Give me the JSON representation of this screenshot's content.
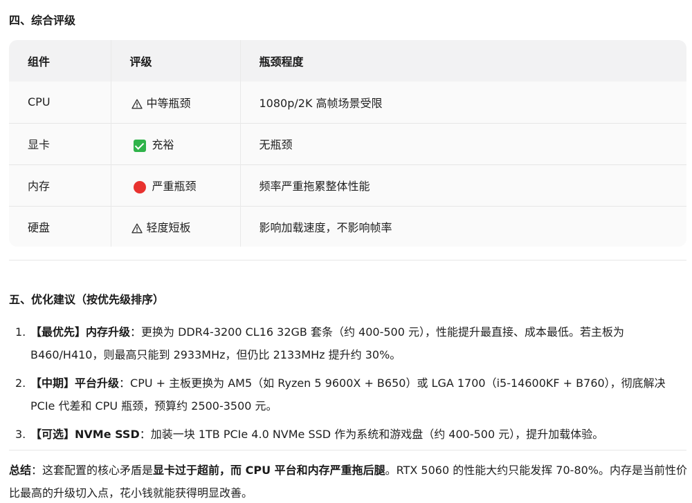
{
  "section4": {
    "title": "四、综合评级",
    "table": {
      "headers": [
        "组件",
        "评级",
        "瓶颈程度"
      ],
      "rows": [
        {
          "component": "CPU",
          "rating_icon": "warning-icon",
          "rating": "中等瓶颈",
          "impact": "1080p/2K 高帧场景受限"
        },
        {
          "component": "显卡",
          "rating_icon": "green-check-icon",
          "rating": "充裕",
          "impact": "无瓶颈"
        },
        {
          "component": "内存",
          "rating_icon": "red-circle-icon",
          "rating": "严重瓶颈",
          "impact": "频率严重拖累整体性能"
        },
        {
          "component": "硬盘",
          "rating_icon": "warning-icon",
          "rating": "轻度短板",
          "impact": "影响加载速度，不影响帧率"
        }
      ]
    }
  },
  "section5": {
    "title": "五、优化建议（按优先级排序）",
    "items": [
      {
        "num": "1.",
        "tag": "【最优先】内存升级",
        "text": "：更换为 DDR4-3200 CL16 32GB 套条（约 400-500 元），性能提升最直接、成本最低。若主板为 B460/H410，则最高只能到 2933MHz，但仍比 2133MHz 提升约 30%。"
      },
      {
        "num": "2.",
        "tag": "【中期】平台升级",
        "text": "：CPU + 主板更换为 AM5（如 Ryzen 5 9600X + B650）或 LGA 1700（i5-14600KF + B760），彻底解决 PCIe 代差和 CPU 瓶颈，预算约 2500-3500 元。"
      },
      {
        "num": "3.",
        "tag": "【可选】NVMe SSD",
        "text": "：加装一块 1TB PCIe 4.0 NVMe SSD 作为系统和游戏盘（约 400-500 元），提升加载体验。"
      }
    ]
  },
  "summary": {
    "label": "总结",
    "text1": "：这套配置的核心矛盾是",
    "bold": "显卡过于超前，而 CPU 平台和内存严重拖后腿",
    "text2": "。RTX 5060 的性能大约只能发挥 70-80%。内存是当前性价比最高的升级切入点，花小钱就能获得明显改善。"
  },
  "colors": {
    "check_green": "#2fb34a",
    "red_dot": "#e8322f"
  }
}
